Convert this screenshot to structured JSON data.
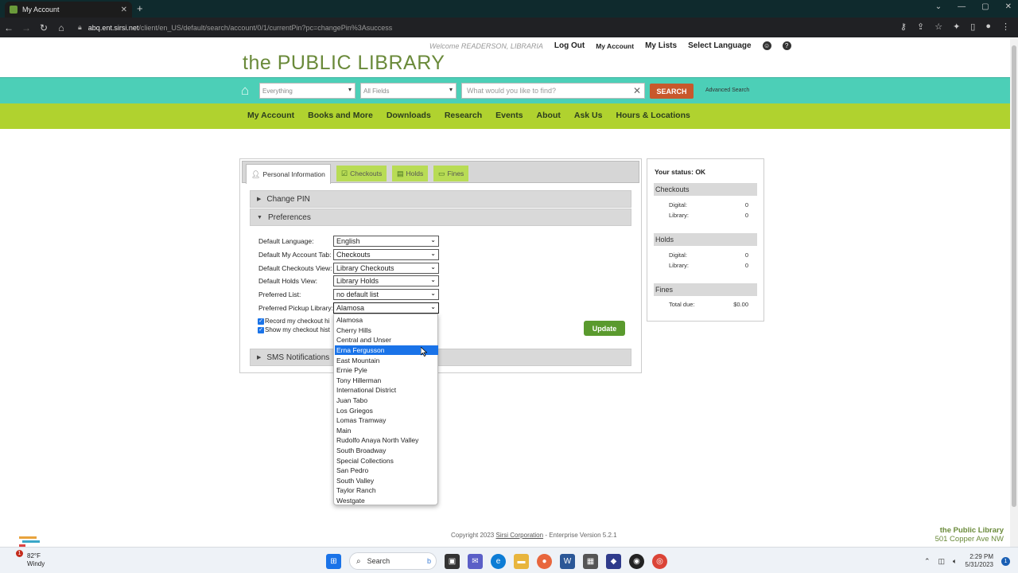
{
  "browser": {
    "tab_title": "My Account",
    "url_host": "abq.ent.sirsi.net",
    "url_path": "/client/en_US/default/search/account/0/1/currentPin?pc=changePin%3Asuccess"
  },
  "header": {
    "welcome": "Welcome READERSON, LIBRARIA",
    "logout": "Log Out",
    "my_account": "My Account",
    "my_lists": "My Lists",
    "select_language": "Select Language",
    "library_title": "the PUBLIC LIBRARY"
  },
  "search": {
    "type_value": "Everything",
    "field_value": "All Fields",
    "placeholder": "What would you like to find?",
    "button": "SEARCH",
    "advanced": "Advanced Search"
  },
  "mainnav": [
    "My Account",
    "Books and More",
    "Downloads",
    "Research",
    "Events",
    "About",
    "Ask Us",
    "Hours & Locations"
  ],
  "tabs": {
    "personal": "Personal Information",
    "checkouts": "Checkouts",
    "holds": "Holds",
    "fines": "Fines"
  },
  "sections": {
    "change_pin": "Change PIN",
    "preferences": "Preferences",
    "sms": "SMS Notifications"
  },
  "prefs": {
    "language_label": "Default Language:",
    "language_value": "English",
    "tab_label": "Default My Account Tab:",
    "tab_value": "Checkouts",
    "checkouts_view_label": "Default Checkouts View:",
    "checkouts_view_value": "Library Checkouts",
    "holds_view_label": "Default Holds View:",
    "holds_view_value": "Library Holds",
    "list_label": "Preferred List:",
    "list_value": "no default list",
    "pickup_label": "Preferred Pickup Library:",
    "pickup_value": "Alamosa",
    "record_history": "Record my checkout hi",
    "show_history": "Show my checkout hist",
    "update": "Update"
  },
  "pickup_options": [
    "Alamosa",
    "Cherry Hills",
    "Central and Unser",
    "Erna Fergusson",
    "East Mountain",
    "Ernie Pyle",
    "Tony Hillerman",
    "International District",
    "Juan Tabo",
    "Los Griegos",
    "Lomas Tramway",
    "Main",
    "Rudolfo Anaya North Valley",
    "South Broadway",
    "Special Collections",
    "San Pedro",
    "South Valley",
    "Taylor Ranch",
    "Westgate"
  ],
  "highlighted_option": "Erna Fergusson",
  "status": {
    "label": "Your status: OK",
    "checkouts_head": "Checkouts",
    "digital_label": "Digital:",
    "digital_checkouts": "0",
    "library_label": "Library:",
    "library_checkouts": "0",
    "holds_head": "Holds",
    "digital_holds": "0",
    "library_holds": "0",
    "fines_head": "Fines",
    "total_due_label": "Total due:",
    "total_due": "$0.00"
  },
  "footer": {
    "copyright": "Copyright 2023",
    "company": "Sirsi Corporation",
    "version": "- Enterprise Version 5.2.1",
    "lib_name": "the Public Library",
    "lib_address": "501 Copper Ave NW"
  },
  "taskbar": {
    "temp": "82°F",
    "weather": "Windy",
    "weather_badge": "1",
    "search": "Search",
    "time": "2:29 PM",
    "date": "5/31/2023",
    "notifications": "1"
  },
  "colors": {
    "teal_bar": "#4ccfb7",
    "green_nav": "#b0d22f",
    "search_button": "#c8582c",
    "update_button": "#5a9a2e",
    "highlight": "#1a73e8"
  }
}
